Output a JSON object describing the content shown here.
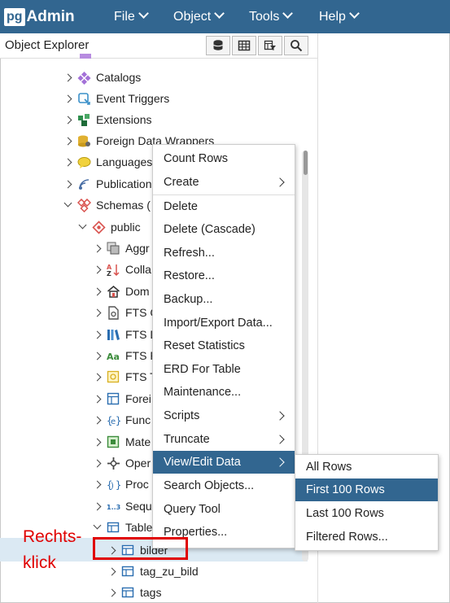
{
  "app": {
    "brand_prefix": "pg",
    "brand_name": "Admin",
    "menus": [
      "File",
      "Object",
      "Tools",
      "Help"
    ]
  },
  "object_explorer": {
    "title": "Object Explorer",
    "toolbar_icons": [
      "database-icon",
      "table-view-icon",
      "filter-table-icon",
      "search-icon"
    ]
  },
  "tree": [
    {
      "label": "Catalogs",
      "icon": "catalogs-icon",
      "expanded": false
    },
    {
      "label": "Event Triggers",
      "icon": "event-trigger-icon",
      "expanded": false
    },
    {
      "label": "Extensions",
      "icon": "extensions-icon",
      "expanded": false
    },
    {
      "label": "Foreign Data Wrappers",
      "icon": "fdw-icon",
      "expanded": false
    },
    {
      "label": "Languages",
      "icon": "languages-icon",
      "expanded": false
    },
    {
      "label": "Publications",
      "icon": "publications-icon",
      "expanded": false
    },
    {
      "label": "Schemas (",
      "icon": "schemas-icon",
      "expanded": true
    },
    {
      "label": "public",
      "icon": "schema-icon",
      "expanded": true
    },
    {
      "label": "Aggr",
      "icon": "aggregates-icon",
      "expanded": false
    },
    {
      "label": "Colla",
      "icon": "collations-icon",
      "expanded": false
    },
    {
      "label": "Dom",
      "icon": "domains-icon",
      "expanded": false
    },
    {
      "label": "FTS C",
      "icon": "fts-config-icon",
      "expanded": false
    },
    {
      "label": "FTS D",
      "icon": "fts-dict-icon",
      "expanded": false
    },
    {
      "label": "FTS P",
      "icon": "fts-parser-icon",
      "expanded": false
    },
    {
      "label": "FTS T",
      "icon": "fts-template-icon",
      "expanded": false
    },
    {
      "label": "Forei",
      "icon": "foreign-table-icon",
      "expanded": false
    },
    {
      "label": "Func",
      "icon": "functions-icon",
      "expanded": false
    },
    {
      "label": "Mate",
      "icon": "mat-view-icon",
      "expanded": false
    },
    {
      "label": "Oper",
      "icon": "operators-icon",
      "expanded": false
    },
    {
      "label": "Proc",
      "icon": "procedures-icon",
      "expanded": false
    },
    {
      "label": "Sequ",
      "icon": "sequences-icon",
      "expanded": false
    },
    {
      "label": "Table",
      "icon": "tables-icon",
      "expanded": true
    },
    {
      "label": "bilder",
      "icon": "table-icon",
      "expanded": false
    },
    {
      "label": "tag_zu_bild",
      "icon": "table-icon",
      "expanded": false
    },
    {
      "label": "tags",
      "icon": "table-icon",
      "expanded": false
    }
  ],
  "context_menu": {
    "items": [
      {
        "label": "Count Rows",
        "submenu": false
      },
      {
        "label": "Create",
        "submenu": true
      },
      {
        "label": "Delete",
        "submenu": false
      },
      {
        "label": "Delete (Cascade)",
        "submenu": false
      },
      {
        "label": "Refresh...",
        "submenu": false
      },
      {
        "label": "Restore...",
        "submenu": false
      },
      {
        "label": "Backup...",
        "submenu": false
      },
      {
        "label": "Import/Export Data...",
        "submenu": false
      },
      {
        "label": "Reset Statistics",
        "submenu": false
      },
      {
        "label": "ERD For Table",
        "submenu": false
      },
      {
        "label": "Maintenance...",
        "submenu": false
      },
      {
        "label": "Scripts",
        "submenu": true
      },
      {
        "label": "Truncate",
        "submenu": true
      },
      {
        "label": "View/Edit Data",
        "submenu": true,
        "active": true
      },
      {
        "label": "Search Objects...",
        "submenu": false
      },
      {
        "label": "Query Tool",
        "submenu": false
      },
      {
        "label": "Properties...",
        "submenu": false
      }
    ]
  },
  "submenu": {
    "items": [
      {
        "label": "All Rows"
      },
      {
        "label": "First 100 Rows",
        "active": true
      },
      {
        "label": "Last 100 Rows"
      },
      {
        "label": "Filtered Rows..."
      }
    ]
  },
  "annotation": {
    "line1": "Rechts-",
    "line2": "klick",
    "color": "#e00000"
  },
  "colors": {
    "navbar": "#326690",
    "selection": "#dbe9f3",
    "highlight": "#326690"
  }
}
